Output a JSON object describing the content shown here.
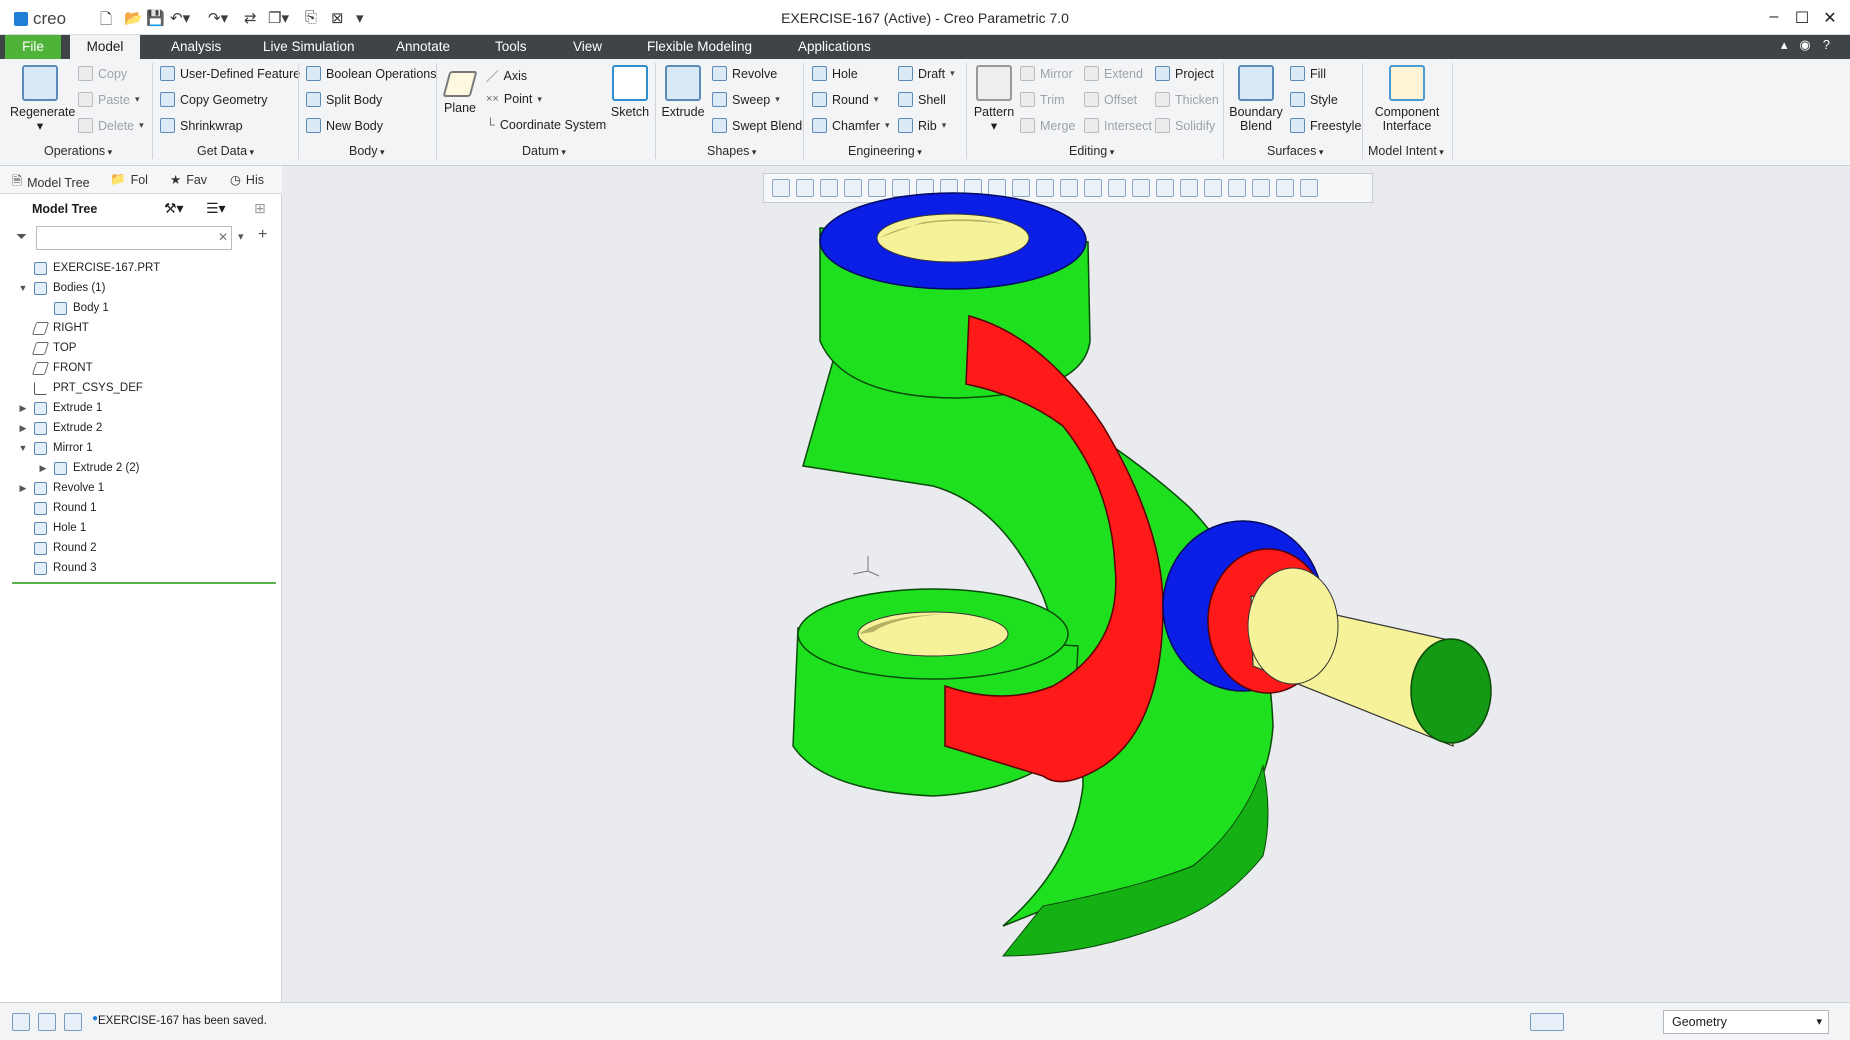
{
  "window": {
    "title": "EXERCISE-167 (Active) - Creo Parametric 7.0",
    "logo": "creo"
  },
  "menu": {
    "tabs": [
      "File",
      "Model",
      "Analysis",
      "Live Simulation",
      "Annotate",
      "Tools",
      "View",
      "Flexible Modeling",
      "Applications"
    ],
    "active": "Model"
  },
  "ribbon": {
    "operations": {
      "regenerate": "Regenerate",
      "copy": "Copy",
      "paste": "Paste",
      "delete": "Delete",
      "group": "Operations"
    },
    "getdata": {
      "udf": "User-Defined Feature",
      "copy_geometry": "Copy Geometry",
      "shrinkwrap": "Shrinkwrap",
      "group": "Get Data"
    },
    "body": {
      "boolean": "Boolean Operations",
      "split": "Split Body",
      "new": "New Body",
      "group": "Body"
    },
    "datum": {
      "plane": "Plane",
      "axis": "Axis",
      "point": "Point",
      "csys": "Coordinate System",
      "sketch": "Sketch",
      "group": "Datum"
    },
    "shapes": {
      "extrude": "Extrude",
      "revolve": "Revolve",
      "sweep": "Sweep",
      "swept_blend": "Swept Blend",
      "group": "Shapes"
    },
    "engineering": {
      "hole": "Hole",
      "round": "Round",
      "chamfer": "Chamfer",
      "draft": "Draft",
      "shell": "Shell",
      "rib": "Rib",
      "group": "Engineering"
    },
    "editing": {
      "pattern": "Pattern",
      "mirror": "Mirror",
      "trim": "Trim",
      "merge": "Merge",
      "extend": "Extend",
      "offset": "Offset",
      "intersect": "Intersect",
      "project": "Project",
      "thicken": "Thicken",
      "solidify": "Solidify",
      "group": "Editing"
    },
    "surfaces": {
      "boundary1": "Boundary",
      "boundary2": "Blend",
      "fill": "Fill",
      "style": "Style",
      "freestyle": "Freestyle",
      "group": "Surfaces"
    },
    "intent": {
      "ci1": "Component",
      "ci2": "Interface",
      "group": "Model Intent"
    }
  },
  "panel": {
    "tabs": [
      "Model Tree",
      "Fol",
      "Fav",
      "His"
    ],
    "header": "Model Tree",
    "search_placeholder": "",
    "tree": [
      {
        "label": "EXERCISE-167.PRT",
        "level": 0,
        "expand": "",
        "icon": "part"
      },
      {
        "label": "Bodies (1)",
        "level": 0,
        "expand": "▼",
        "icon": "bodies"
      },
      {
        "label": "Body 1",
        "level": 1,
        "expand": "",
        "icon": "body"
      },
      {
        "label": "RIGHT",
        "level": 0,
        "expand": "",
        "icon": "plane"
      },
      {
        "label": "TOP",
        "level": 0,
        "expand": "",
        "icon": "plane"
      },
      {
        "label": "FRONT",
        "level": 0,
        "expand": "",
        "icon": "plane"
      },
      {
        "label": "PRT_CSYS_DEF",
        "level": 0,
        "expand": "",
        "icon": "csys"
      },
      {
        "label": "Extrude 1",
        "level": 0,
        "expand": "▶",
        "icon": "extrude"
      },
      {
        "label": "Extrude 2",
        "level": 0,
        "expand": "▶",
        "icon": "extrude"
      },
      {
        "label": "Mirror 1",
        "level": 0,
        "expand": "▼",
        "icon": "mirror"
      },
      {
        "label": "Extrude 2 (2)",
        "level": 1,
        "expand": "▶",
        "icon": "extrude"
      },
      {
        "label": "Revolve 1",
        "level": 0,
        "expand": "▶",
        "icon": "revolve"
      },
      {
        "label": "Round 1",
        "level": 0,
        "expand": "",
        "icon": "round"
      },
      {
        "label": "Hole 1",
        "level": 0,
        "expand": "",
        "icon": "hole"
      },
      {
        "label": "Round 2",
        "level": 0,
        "expand": "",
        "icon": "round"
      },
      {
        "label": "Round 3",
        "level": 0,
        "expand": "",
        "icon": "round"
      }
    ]
  },
  "status": {
    "message": "EXERCISE-167 has been saved.",
    "filter": "Geometry"
  },
  "colors": {
    "file_tab": "#4fb33a",
    "menubar": "#3e4447",
    "model_green": "#1fe01f",
    "model_red": "#ff1a1a",
    "model_blue": "#0a1ee6",
    "model_yellow": "#f5f29a"
  }
}
